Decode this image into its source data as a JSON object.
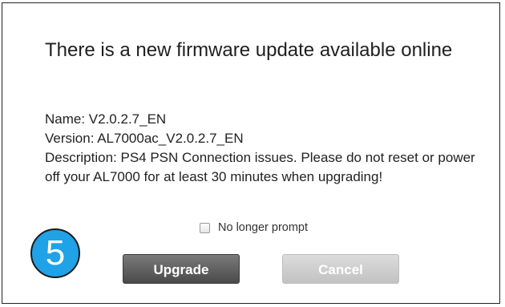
{
  "dialog": {
    "title": "There is a new firmware update available online",
    "name_line": "Name: V2.0.2.7_EN",
    "version_line": "Version: AL7000ac_V2.0.2.7_EN",
    "description_line": "Description: PS4 PSN Connection issues. Please do not reset or power off your AL7000 for at least 30 minutes when upgrading!",
    "no_longer_prompt_label": "No longer prompt",
    "upgrade_label": "Upgrade",
    "cancel_label": "Cancel"
  },
  "step_badge": {
    "number": "5",
    "color": "#1fa2e6"
  },
  "colors": {
    "upgrade_button": "#555555",
    "cancel_button": "#cfcfcf"
  }
}
